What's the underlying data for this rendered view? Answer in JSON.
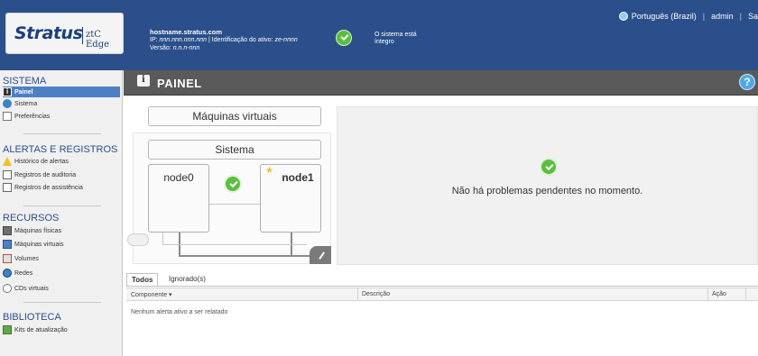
{
  "header": {
    "logo_main": "Stratus",
    "logo_sub": "ztC Edge",
    "hostname": "hostname.stratus.com",
    "ip_line": {
      "ip_prefix": "IP: ",
      "ip_value": "nnn.nnn.nnn.nnn",
      "asset_prefix": " | Identificação do ativo: ",
      "asset_value": "ze-nnnn"
    },
    "version_line": {
      "prefix": "Versão: ",
      "value": "n.n.n-nnn"
    },
    "status_line1": "O sistema está",
    "status_line2": "íntegro",
    "language": "Português (Brazil)",
    "user": "admin",
    "logout_partial": "Sa"
  },
  "sidebar": {
    "sections": [
      {
        "title": "SISTEMA",
        "items": [
          {
            "label": "Painel",
            "icon": "info-icon",
            "active": true
          },
          {
            "label": "Sistema",
            "icon": "system-globe-icon"
          },
          {
            "label": "Preferências",
            "icon": "preferences-icon"
          }
        ]
      },
      {
        "title": "ALERTAS E REGISTROS",
        "items": [
          {
            "label": "Histórico de alertas",
            "icon": "warning-icon"
          },
          {
            "label": "Registros de auditoria",
            "icon": "document-icon"
          },
          {
            "label": "Registros de assistência",
            "icon": "support-document-icon"
          }
        ]
      },
      {
        "title": "RECURSOS",
        "items": [
          {
            "label": "Máquinas físicas",
            "icon": "server-icon"
          },
          {
            "label": "Máquinas virtuais",
            "icon": "vm-icon"
          },
          {
            "label": "Volumes",
            "icon": "volume-icon"
          },
          {
            "label": "Redes",
            "icon": "network-icon"
          },
          {
            "label": "CDs virtuais",
            "icon": "cd-icon"
          }
        ]
      },
      {
        "title": "BIBLIOTECA",
        "items": [
          {
            "label": "Kits de atualização",
            "icon": "kit-icon"
          }
        ]
      }
    ]
  },
  "panel": {
    "title": "PAINEL",
    "help": "?"
  },
  "diagram": {
    "vm_label": "Máquinas virtuais",
    "system_label": "Sistema",
    "node0": "node0",
    "node1": "node1"
  },
  "status_message": "Não há problemas pendentes no momento.",
  "alerts": {
    "tabs": [
      "Todos",
      "Ignorado(s)"
    ],
    "columns": [
      "Componente",
      "Descrição",
      "Ação"
    ],
    "sort_indicator": "▾",
    "empty_text": "Nenhum alerta ativo a ser relatado"
  },
  "colors": {
    "header_bg": "#2a4f8a",
    "active_nav": "#4d7fc7",
    "status_ok": "#5bbf3e",
    "panel_bar": "#5a5a5a"
  }
}
